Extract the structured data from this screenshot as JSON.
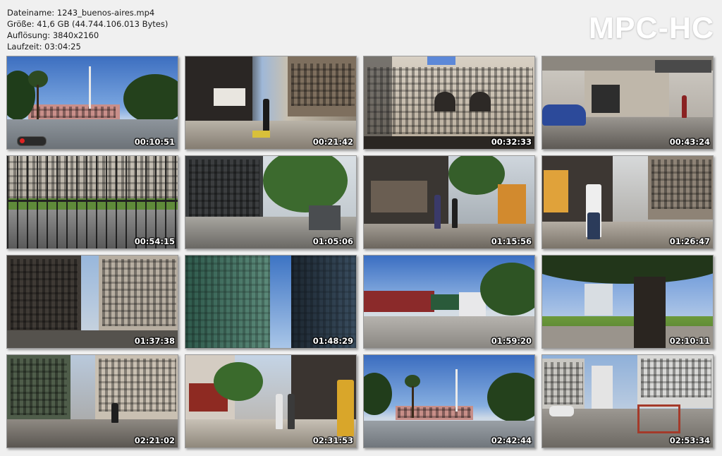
{
  "header": {
    "filename": "Dateiname: 1243_buenos-aires.mp4",
    "size": "Größe: 41,6 GB (44.744.106.013 Bytes)",
    "resolution": "Auflösung: 3840x2160",
    "duration": "Laufzeit: 03:04:25"
  },
  "logo": "MPC-HC",
  "thumbnails": [
    {
      "time": "00:10:51",
      "scene": "plaza-pink-house"
    },
    {
      "time": "00:21:42",
      "scene": "street-walker"
    },
    {
      "time": "00:32:33",
      "scene": "old-facade"
    },
    {
      "time": "00:43:24",
      "scene": "corner-blue-car"
    },
    {
      "time": "00:54:15",
      "scene": "iron-fence"
    },
    {
      "time": "01:05:06",
      "scene": "tree-boulevard"
    },
    {
      "time": "01:15:56",
      "scene": "pedestrian-street"
    },
    {
      "time": "01:26:47",
      "scene": "man-white-shirt"
    },
    {
      "time": "01:37:38",
      "scene": "narrow-buildings"
    },
    {
      "time": "01:48:29",
      "scene": "glass-towers"
    },
    {
      "time": "01:59:20",
      "scene": "buses-avenue"
    },
    {
      "time": "02:10:11",
      "scene": "big-tree-park"
    },
    {
      "time": "02:21:02",
      "scene": "cyclist-street"
    },
    {
      "time": "02:31:53",
      "scene": "shopping-street"
    },
    {
      "time": "02:42:44",
      "scene": "plaza-palm"
    },
    {
      "time": "02:53:34",
      "scene": "intersection"
    }
  ]
}
